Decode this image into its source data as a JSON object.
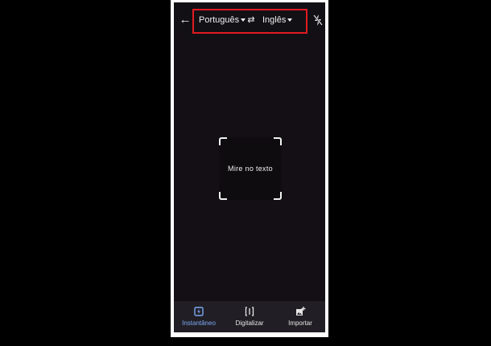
{
  "header": {
    "source_language": "Português",
    "target_language": "Inglês",
    "back_icon": "arrow-left-icon",
    "swap_icon": "swap-arrows-icon",
    "flash_icon": "flash-off-icon"
  },
  "viewfinder": {
    "prompt": "Mire no texto"
  },
  "bottom_tabs": [
    {
      "label": "Instantâneo",
      "icon": "instant-camera-icon",
      "active": true
    },
    {
      "label": "Digitalizar",
      "icon": "scan-icon",
      "active": false
    },
    {
      "label": "Importar",
      "icon": "import-image-icon",
      "active": false
    }
  ],
  "colors": {
    "highlight_border": "#e11b22",
    "active_tab": "#7fa7f6",
    "screen_bg": "#130f14",
    "bottom_bar_bg": "#211f25"
  }
}
